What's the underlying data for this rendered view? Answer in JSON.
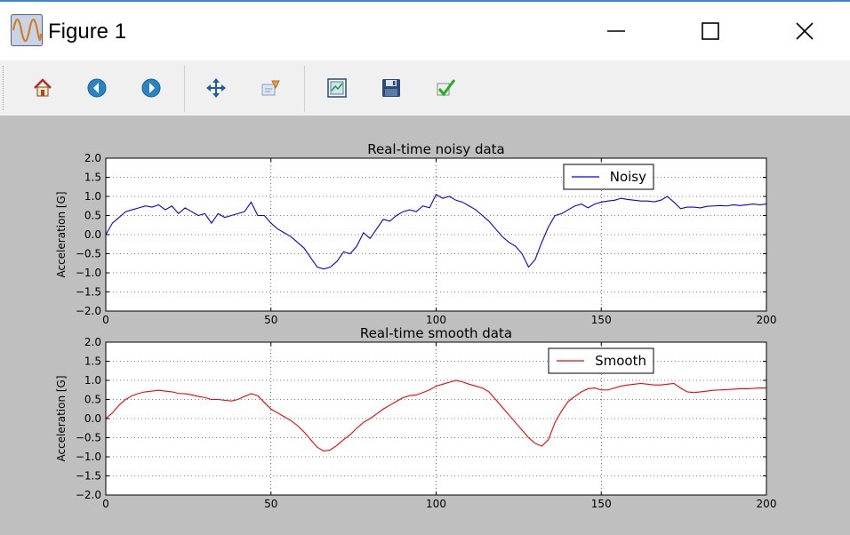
{
  "window": {
    "title": "Figure 1",
    "accent_color": "#3c86d6",
    "icons": {
      "app": "waveform-app-icon",
      "minimize": "minimize-icon",
      "maximize": "maximize-icon",
      "close": "close-icon"
    }
  },
  "toolbar": {
    "buttons": [
      {
        "name": "home",
        "icon": "home-icon"
      },
      {
        "name": "back",
        "icon": "arrow-left-icon"
      },
      {
        "name": "forward",
        "icon": "arrow-right-icon"
      },
      {
        "name": "pan",
        "icon": "move-arrows-icon"
      },
      {
        "name": "zoom",
        "icon": "zoom-rect-icon"
      },
      {
        "name": "subplots",
        "icon": "configure-subplots-icon"
      },
      {
        "name": "save",
        "icon": "floppy-disk-icon"
      },
      {
        "name": "edit",
        "icon": "checkmark-icon"
      }
    ]
  },
  "chart_data": [
    {
      "type": "line",
      "title": "Real-time noisy data",
      "xlabel": "",
      "ylabel": "Acceleration [G]",
      "xlim": [
        0,
        200
      ],
      "ylim": [
        -2.0,
        2.0
      ],
      "x_ticks": [
        "0",
        "50",
        "100",
        "150",
        "200"
      ],
      "y_ticks": [
        "2.0",
        "1.5",
        "1.0",
        "0.5",
        "0.0",
        "−0.5",
        "−1.0",
        "−1.5",
        "−2.0"
      ],
      "grid": true,
      "legend_position": "top-right",
      "series": [
        {
          "name": "Noisy",
          "color": "#0000ff",
          "x": [
            0,
            2,
            4,
            6,
            8,
            10,
            12,
            14,
            16,
            18,
            20,
            22,
            24,
            26,
            28,
            30,
            32,
            34,
            36,
            38,
            40,
            42,
            44,
            46,
            48,
            50,
            52,
            54,
            56,
            58,
            60,
            62,
            64,
            66,
            68,
            70,
            72,
            74,
            76,
            78,
            80,
            82,
            84,
            86,
            88,
            90,
            92,
            94,
            96,
            98,
            100,
            102,
            104,
            106,
            108,
            110,
            112,
            114,
            116,
            118,
            120,
            122,
            124,
            126,
            128,
            130,
            132,
            134,
            136,
            138,
            140,
            142,
            144,
            146,
            148,
            150,
            152,
            154,
            156,
            158,
            160,
            162,
            164,
            166,
            168,
            170,
            172,
            174,
            176,
            178,
            180,
            182,
            184,
            186,
            188,
            190,
            192,
            194,
            196,
            198,
            200
          ],
          "values": [
            0.0,
            0.3,
            0.45,
            0.6,
            0.65,
            0.7,
            0.75,
            0.72,
            0.78,
            0.65,
            0.75,
            0.55,
            0.7,
            0.6,
            0.5,
            0.55,
            0.3,
            0.55,
            0.45,
            0.5,
            0.55,
            0.6,
            0.85,
            0.5,
            0.5,
            0.3,
            0.15,
            0.05,
            -0.05,
            -0.2,
            -0.35,
            -0.6,
            -0.85,
            -0.9,
            -0.85,
            -0.7,
            -0.45,
            -0.5,
            -0.3,
            0.05,
            -0.1,
            0.15,
            0.4,
            0.35,
            0.5,
            0.6,
            0.65,
            0.6,
            0.75,
            0.7,
            1.05,
            0.95,
            1.0,
            0.9,
            0.85,
            0.75,
            0.65,
            0.5,
            0.35,
            0.15,
            -0.05,
            -0.2,
            -0.3,
            -0.5,
            -0.85,
            -0.65,
            -0.2,
            0.2,
            0.5,
            0.55,
            0.65,
            0.75,
            0.8,
            0.7,
            0.8,
            0.85,
            0.88,
            0.9,
            0.95,
            0.92,
            0.9,
            0.88,
            0.88,
            0.86,
            0.9,
            1.0,
            0.85,
            0.68,
            0.72,
            0.72,
            0.7,
            0.74,
            0.75,
            0.76,
            0.75,
            0.78,
            0.76,
            0.78,
            0.8,
            0.78,
            0.8
          ]
        }
      ]
    },
    {
      "type": "line",
      "title": "Real-time smooth data",
      "xlabel": "",
      "ylabel": "Acceleration [G]",
      "xlim": [
        0,
        200
      ],
      "ylim": [
        -2.0,
        2.0
      ],
      "x_ticks": [
        "0",
        "50",
        "100",
        "150",
        "200"
      ],
      "y_ticks": [
        "2.0",
        "1.5",
        "1.0",
        "0.5",
        "0.0",
        "−0.5",
        "−1.0",
        "−1.5",
        "−2.0"
      ],
      "grid": true,
      "legend_position": "top-right",
      "series": [
        {
          "name": "Smooth",
          "color": "#ff0000",
          "x": [
            0,
            2,
            4,
            6,
            8,
            10,
            12,
            14,
            16,
            18,
            20,
            22,
            24,
            26,
            28,
            30,
            32,
            34,
            36,
            38,
            40,
            42,
            44,
            46,
            48,
            50,
            52,
            54,
            56,
            58,
            60,
            62,
            64,
            66,
            68,
            70,
            72,
            74,
            76,
            78,
            80,
            82,
            84,
            86,
            88,
            90,
            92,
            94,
            96,
            98,
            100,
            102,
            104,
            106,
            108,
            110,
            112,
            114,
            116,
            118,
            120,
            122,
            124,
            126,
            128,
            130,
            132,
            134,
            136,
            138,
            140,
            142,
            144,
            146,
            148,
            150,
            152,
            154,
            156,
            158,
            160,
            162,
            164,
            166,
            168,
            170,
            172,
            174,
            176,
            178,
            180,
            182,
            184,
            186,
            188,
            190,
            192,
            194,
            196,
            198,
            200
          ],
          "values": [
            0.0,
            0.15,
            0.35,
            0.5,
            0.6,
            0.66,
            0.7,
            0.72,
            0.74,
            0.72,
            0.7,
            0.66,
            0.65,
            0.62,
            0.58,
            0.55,
            0.5,
            0.5,
            0.48,
            0.46,
            0.5,
            0.58,
            0.65,
            0.6,
            0.42,
            0.25,
            0.15,
            0.05,
            -0.05,
            -0.18,
            -0.35,
            -0.55,
            -0.75,
            -0.85,
            -0.82,
            -0.7,
            -0.55,
            -0.42,
            -0.25,
            -0.1,
            0.0,
            0.12,
            0.25,
            0.35,
            0.45,
            0.55,
            0.6,
            0.62,
            0.68,
            0.75,
            0.85,
            0.9,
            0.95,
            1.0,
            0.96,
            0.9,
            0.85,
            0.8,
            0.7,
            0.5,
            0.3,
            0.1,
            -0.1,
            -0.3,
            -0.5,
            -0.65,
            -0.72,
            -0.55,
            -0.1,
            0.2,
            0.45,
            0.58,
            0.7,
            0.78,
            0.8,
            0.75,
            0.75,
            0.8,
            0.85,
            0.88,
            0.9,
            0.92,
            0.9,
            0.88,
            0.88,
            0.9,
            0.92,
            0.8,
            0.7,
            0.68,
            0.7,
            0.72,
            0.74,
            0.75,
            0.76,
            0.77,
            0.78,
            0.78,
            0.79,
            0.8,
            0.8
          ]
        }
      ]
    }
  ]
}
